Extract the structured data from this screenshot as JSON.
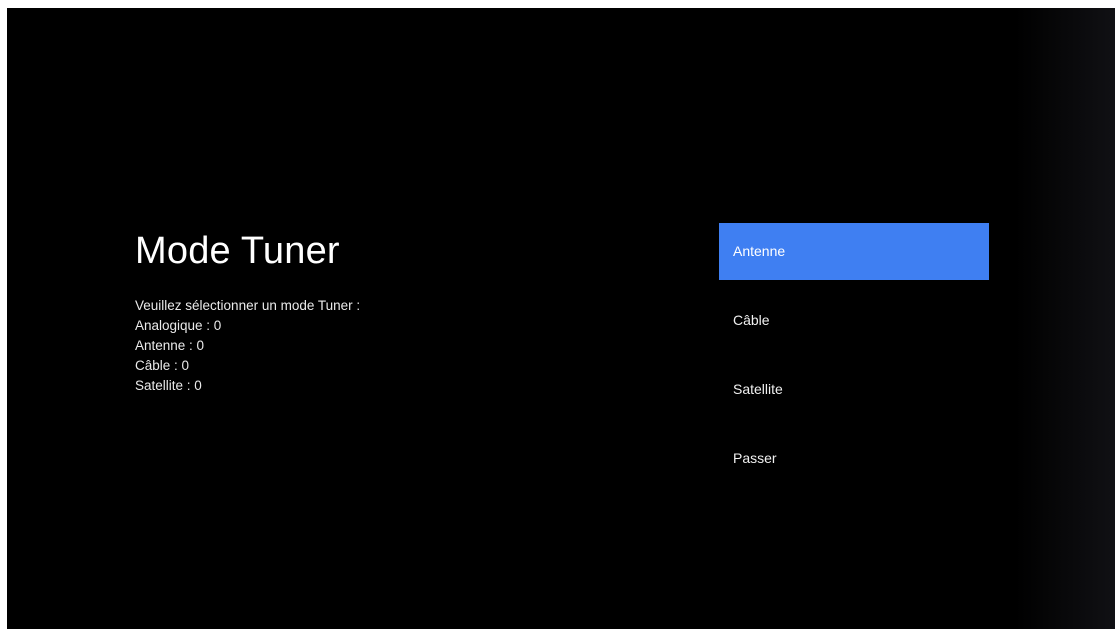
{
  "screen": {
    "title": "Mode Tuner",
    "description_lines": [
      "Veuillez sélectionner un mode Tuner :",
      "Analogique : 0",
      "Antenne : 0",
      "Câble : 0",
      "Satellite : 0"
    ]
  },
  "menu": {
    "selected_index": 0,
    "accent_color": "#3f7ff2",
    "items": [
      {
        "label": "Antenne"
      },
      {
        "label": "Câble"
      },
      {
        "label": "Satellite"
      },
      {
        "label": "Passer"
      }
    ]
  }
}
